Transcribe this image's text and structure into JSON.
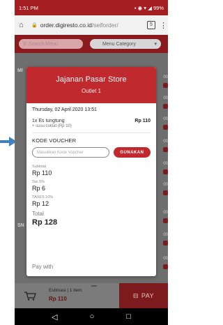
{
  "status_bar": {
    "time": "1:51 PM",
    "battery": "99%"
  },
  "browser": {
    "domain": "order.digiresto.co.id",
    "path": "/selforder/",
    "tab_count": "5"
  },
  "app_header": {
    "search_placeholder": "Search Menu",
    "category_label": "Menu Category"
  },
  "background": {
    "section1_label": "MI",
    "section2_label": "SN",
    "price_fragments": [
      "00",
      "00",
      "00",
      "00",
      "00",
      "00",
      "00",
      "00",
      "00"
    ]
  },
  "modal": {
    "store_name": "Jajanan Pasar Store",
    "outlet": "Outlet 1",
    "order_date": "Thursday, 02 April 2020 13:51",
    "item": {
      "name": "1x Es tungtung",
      "addon": "+ susu coklat (Rp 10)",
      "price": "Rp 110"
    },
    "voucher": {
      "title": "KODE VOUCHER",
      "placeholder": "Masukkan Kode Voucher",
      "button": "GUNAKAN"
    },
    "summary": {
      "subtotal_label": "Subtotal",
      "subtotal_value": "Rp 110",
      "tax_label": "Tax 5%",
      "tax_value": "Rp 6",
      "taxes_label": "TAXES 10%",
      "taxes_value": "Rp 12",
      "total_label": "Total",
      "total_value": "Rp 128"
    },
    "pay_with": "Pay with"
  },
  "bottom_bar": {
    "estimasi": "Estimasi | 1 item",
    "total": "Rp 110",
    "pay_label": "PAY"
  },
  "colors": {
    "brand_red": "#c02a2e",
    "status_red": "#a51e22",
    "arrow_blue": "#3d82c4"
  }
}
